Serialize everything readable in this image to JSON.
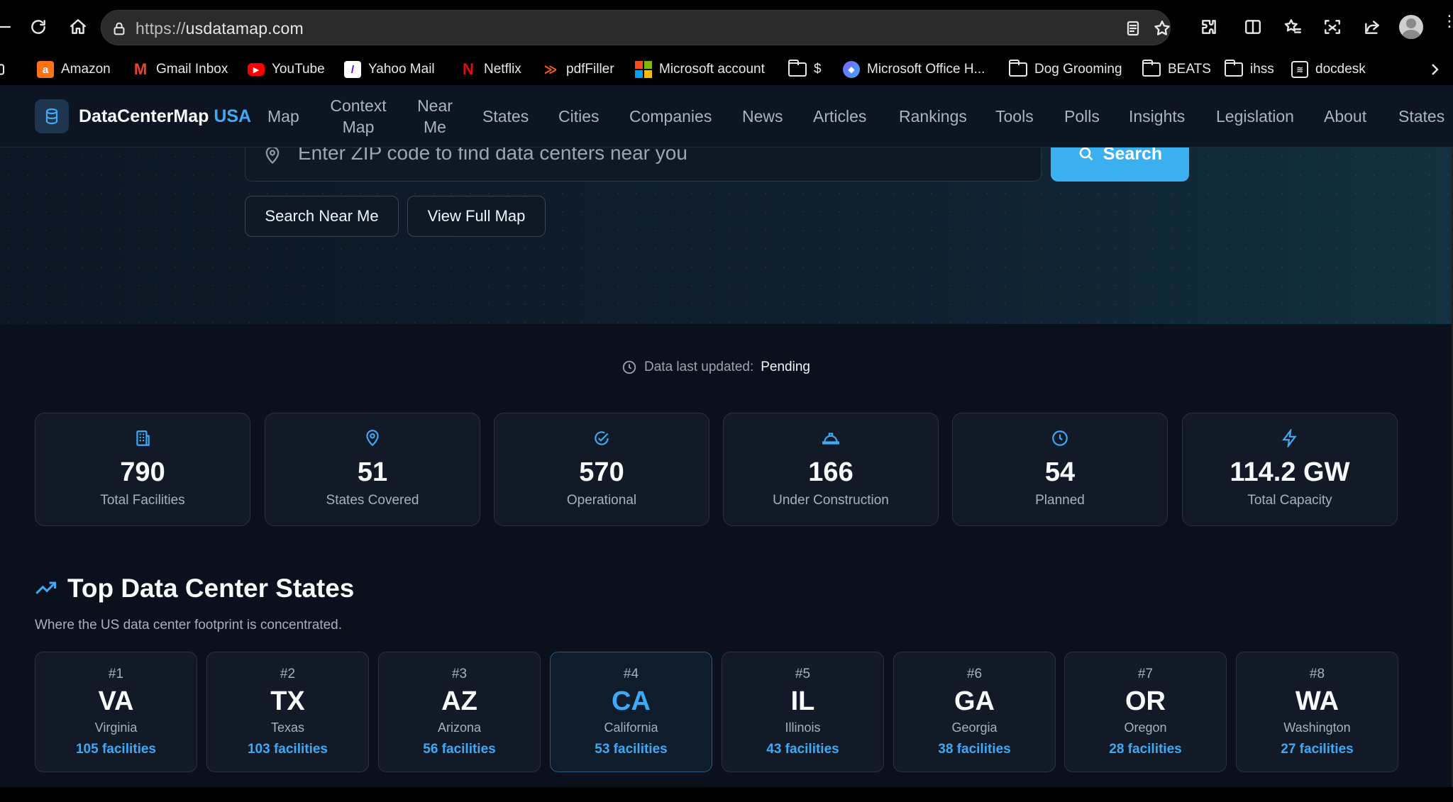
{
  "browser": {
    "url_prefix": "https://",
    "url_host": "usdatamap.com"
  },
  "bookmarks": [
    {
      "label": "Amazon",
      "icon": "amazon-icon"
    },
    {
      "label": "Gmail Inbox",
      "icon": "gmail-icon"
    },
    {
      "label": "YouTube",
      "icon": "youtube-icon"
    },
    {
      "label": "Yahoo Mail",
      "icon": "yahoo-icon"
    },
    {
      "label": "Netflix",
      "icon": "netflix-icon"
    },
    {
      "label": "pdfFiller",
      "icon": "pdffiller-icon"
    },
    {
      "label": "Microsoft account",
      "icon": "microsoft-icon"
    },
    {
      "label": "$",
      "icon": "folder-icon"
    },
    {
      "label": "Microsoft Office H...",
      "icon": "office-icon"
    },
    {
      "label": "Dog Grooming",
      "icon": "folder-icon"
    },
    {
      "label": "BEATS",
      "icon": "folder-icon"
    },
    {
      "label": "ihss",
      "icon": "folder-icon"
    },
    {
      "label": "docdesk",
      "icon": "docdesk-icon"
    }
  ],
  "site": {
    "brand_main": "DataCenterMap",
    "brand_accent": "USA",
    "nav": [
      "Map",
      "Context Map",
      "Near Me",
      "States",
      "Cities",
      "Companies",
      "News",
      "Articles",
      "Rankings",
      "Tools",
      "Polls",
      "Insights",
      "Legislation",
      "About",
      "States"
    ]
  },
  "hero": {
    "zip_placeholder": "Enter ZIP code to find data centers near you",
    "search_label": "Search",
    "near_me_label": "Search Near Me",
    "full_map_label": "View Full Map"
  },
  "updated": {
    "label": "Data last updated:",
    "value": "Pending"
  },
  "stats": [
    {
      "value": "790",
      "label": "Total Facilities",
      "icon": "building-icon"
    },
    {
      "value": "51",
      "label": "States Covered",
      "icon": "map-pin-icon"
    },
    {
      "value": "570",
      "label": "Operational",
      "icon": "check-circle-icon"
    },
    {
      "value": "166",
      "label": "Under Construction",
      "icon": "hard-hat-icon"
    },
    {
      "value": "54",
      "label": "Planned",
      "icon": "clock-icon"
    },
    {
      "value": "114.2 GW",
      "label": "Total Capacity",
      "icon": "lightning-icon"
    }
  ],
  "top_states": {
    "title": "Top Data Center States",
    "subtitle": "Where the US data center footprint is concentrated.",
    "items": [
      {
        "rank": "#1",
        "abbr": "VA",
        "name": "Virginia",
        "facilities": "105 facilities"
      },
      {
        "rank": "#2",
        "abbr": "TX",
        "name": "Texas",
        "facilities": "103 facilities"
      },
      {
        "rank": "#3",
        "abbr": "AZ",
        "name": "Arizona",
        "facilities": "56 facilities"
      },
      {
        "rank": "#4",
        "abbr": "CA",
        "name": "California",
        "facilities": "53 facilities"
      },
      {
        "rank": "#5",
        "abbr": "IL",
        "name": "Illinois",
        "facilities": "43 facilities"
      },
      {
        "rank": "#6",
        "abbr": "GA",
        "name": "Georgia",
        "facilities": "38 facilities"
      },
      {
        "rank": "#7",
        "abbr": "OR",
        "name": "Oregon",
        "facilities": "28 facilities"
      },
      {
        "rank": "#8",
        "abbr": "WA",
        "name": "Washington",
        "facilities": "27 facilities"
      }
    ]
  },
  "colors": {
    "accent": "#3ea9f5",
    "page_bg": "#0b111c",
    "card_bg": "#121a27"
  }
}
